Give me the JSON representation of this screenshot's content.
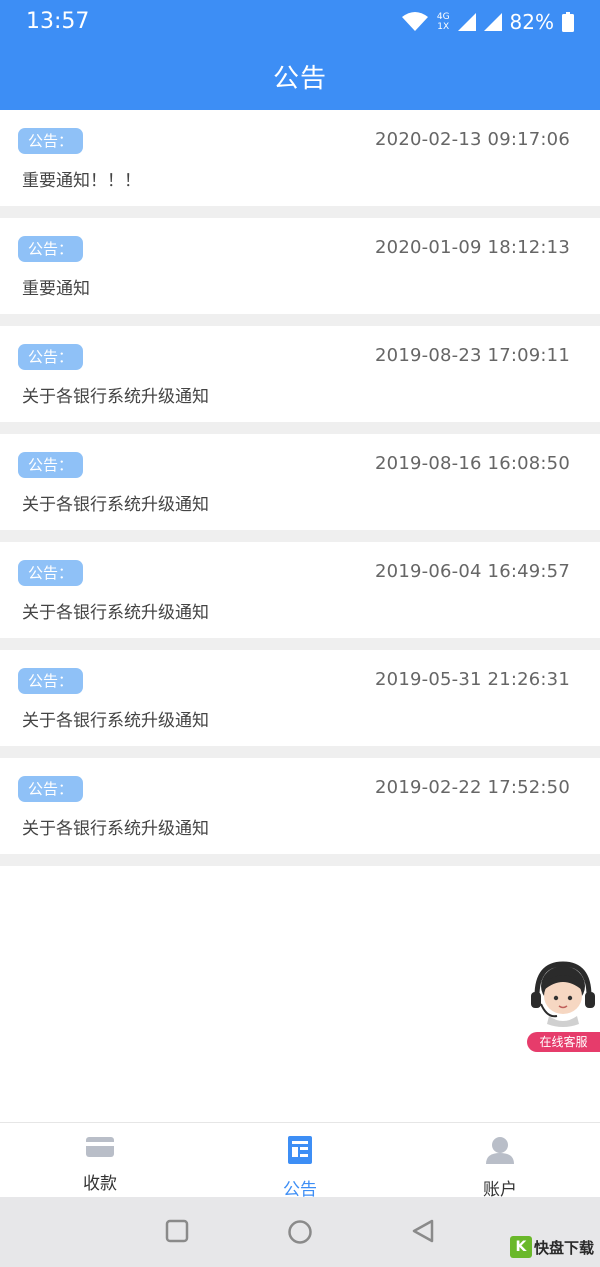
{
  "status_bar": {
    "time": "13:57",
    "network_top": "4G",
    "network_bottom": "1X",
    "battery_percent": "82%"
  },
  "header": {
    "title": "公告"
  },
  "notices": [
    {
      "badge": "公告：",
      "date": "2020-02-13 09:17:06",
      "title": "重要通知！！！"
    },
    {
      "badge": "公告：",
      "date": "2020-01-09 18:12:13",
      "title": "重要通知"
    },
    {
      "badge": "公告：",
      "date": "2019-08-23 17:09:11",
      "title": "关于各银行系统升级通知"
    },
    {
      "badge": "公告：",
      "date": "2019-08-16 16:08:50",
      "title": "关于各银行系统升级通知"
    },
    {
      "badge": "公告：",
      "date": "2019-06-04 16:49:57",
      "title": "关于各银行系统升级通知"
    },
    {
      "badge": "公告：",
      "date": "2019-05-31 21:26:31",
      "title": "关于各银行系统升级通知"
    },
    {
      "badge": "公告：",
      "date": "2019-02-22 17:52:50",
      "title": "关于各银行系统升级通知"
    }
  ],
  "customer_service": {
    "label": "在线客服"
  },
  "bottom_nav": [
    {
      "label": "收款",
      "icon": "card-icon",
      "active": false
    },
    {
      "label": "公告",
      "icon": "notice-icon",
      "active": true
    },
    {
      "label": "账户",
      "icon": "user-icon",
      "active": false
    }
  ],
  "watermark": {
    "badge": "K",
    "text": "快盘下载"
  },
  "colors": {
    "primary": "#3d8ef5",
    "badge": "#8fc1f7",
    "separator": "#efefef",
    "cs_label": "#e63c6b",
    "inactive_icon": "#b9bec8"
  }
}
